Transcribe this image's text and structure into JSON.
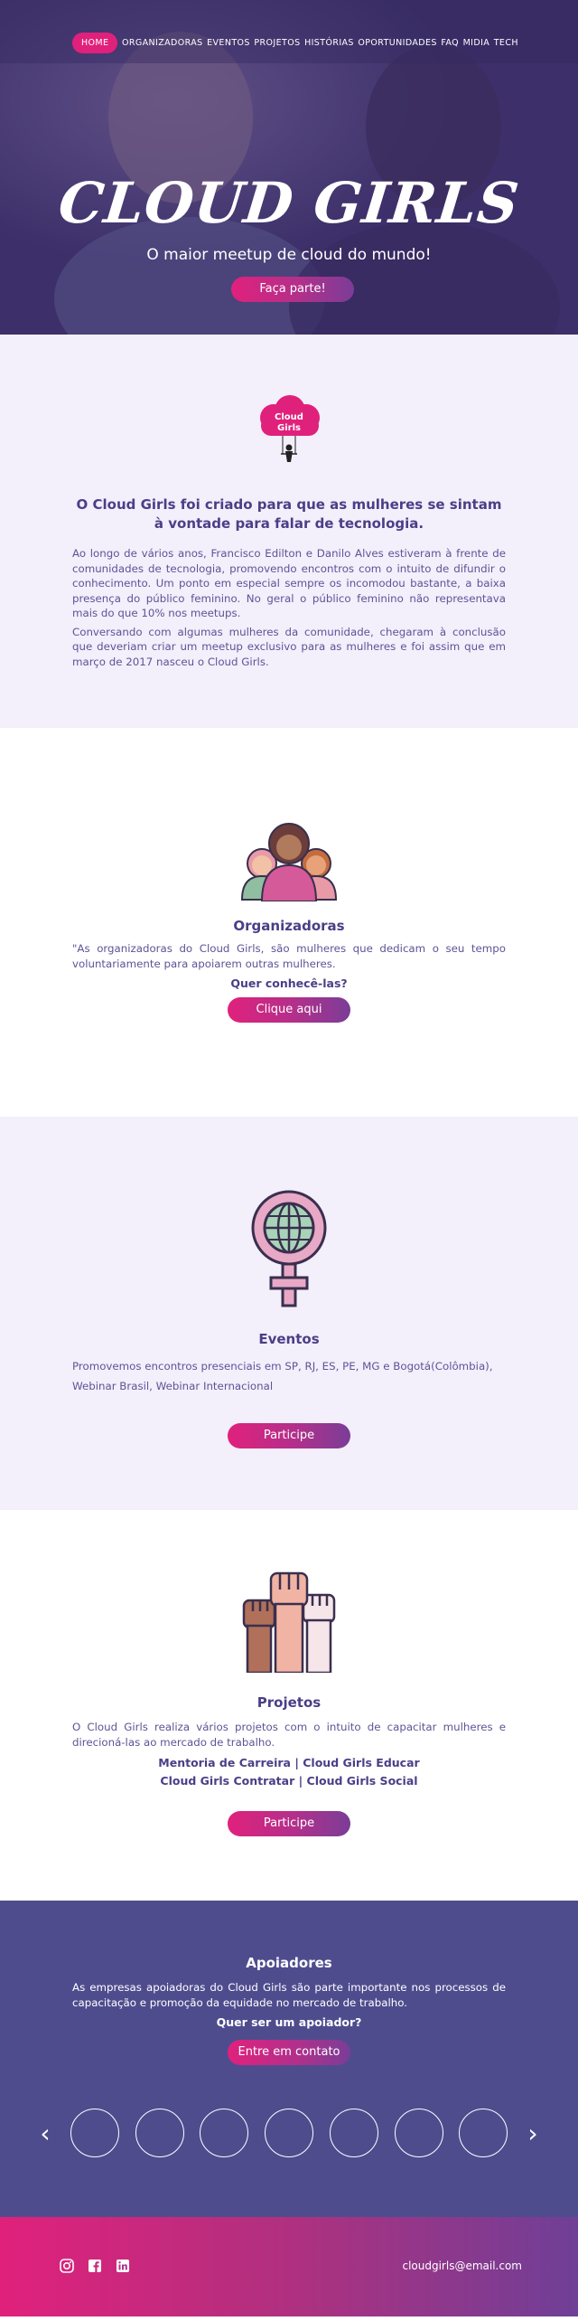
{
  "nav": {
    "items": [
      {
        "label": "HOME",
        "active": true
      },
      {
        "label": "ORGANIZADORAS"
      },
      {
        "label": "EVENTOS"
      },
      {
        "label": "PROJETOS"
      },
      {
        "label": "HISTÓRIAS"
      },
      {
        "label": "OPORTUNIDADES"
      },
      {
        "label": "FAQ"
      },
      {
        "label": "MIDIA"
      },
      {
        "label": "TECH"
      }
    ]
  },
  "hero": {
    "title": "CLOUD GIRLS",
    "subtitle": "O maior meetup de cloud do mundo!",
    "cta": "Faça parte!"
  },
  "about": {
    "logo_text_1": "Cloud",
    "logo_text_2": "Girls",
    "heading": "O Cloud Girls foi criado para que as mulheres se sintam à vontade para falar de tecnologia.",
    "p1": "Ao longo de vários anos, Francisco Edilton e Danilo Alves estiveram à frente de comunidades de tecnologia, promovendo encontros com o intuito de difundir o conhecimento. Um ponto em especial sempre os incomodou bastante, a baixa presença do público feminino. No geral o público feminino não representava mais do que 10% nos meetups.",
    "p2": "Conversando com algumas mulheres da comunidade, chegaram à conclusão que deveriam criar um meetup exclusivo para as mulheres e foi assim que em março de 2017 nasceu o Cloud Girls."
  },
  "organizers": {
    "icon": "women-group-icon",
    "title": "Organizadoras",
    "text": "\"As organizadoras do Cloud Girls, são mulheres que dedicam o seu tempo voluntariamente para apoiarem outras mulheres.",
    "question": "Quer conhecê-las?",
    "cta": "Clique aqui"
  },
  "events": {
    "icon": "female-globe-icon",
    "title": "Eventos",
    "text": "Promovemos encontros presenciais em SP, RJ, ES, PE, MG e Bogotá(Colômbia), Webinar Brasil, Webinar Internacional",
    "cta": "Participe"
  },
  "projects": {
    "icon": "raised-fists-icon",
    "title": "Projetos",
    "text": "O Cloud Girls realiza vários projetos com o intuito de capacitar mulheres e direcioná-las ao mercado de trabalho.",
    "line1": "Mentoria de Carreira | Cloud Girls Educar",
    "line2": "Cloud Girls Contratar | Cloud Girls Social",
    "cta": "Participe"
  },
  "supporters": {
    "title": "Apoiadores",
    "text": "As empresas apoiadoras do Cloud Girls são parte importante nos processos de capacitação e promoção da equidade no mercado de trabalho.",
    "question": "Quer ser um apoiador?",
    "cta": "Entre em contato",
    "prev": "‹",
    "next": "›"
  },
  "footer": {
    "email": "cloudgirls@email.com",
    "icons": [
      "instagram-icon",
      "facebook-icon",
      "linkedin-icon"
    ]
  },
  "colors": {
    "primary": "#e0217c",
    "purple": "#4a3f87",
    "lavender": "#f3effb",
    "supporters_bg": "#4f4c8e"
  }
}
